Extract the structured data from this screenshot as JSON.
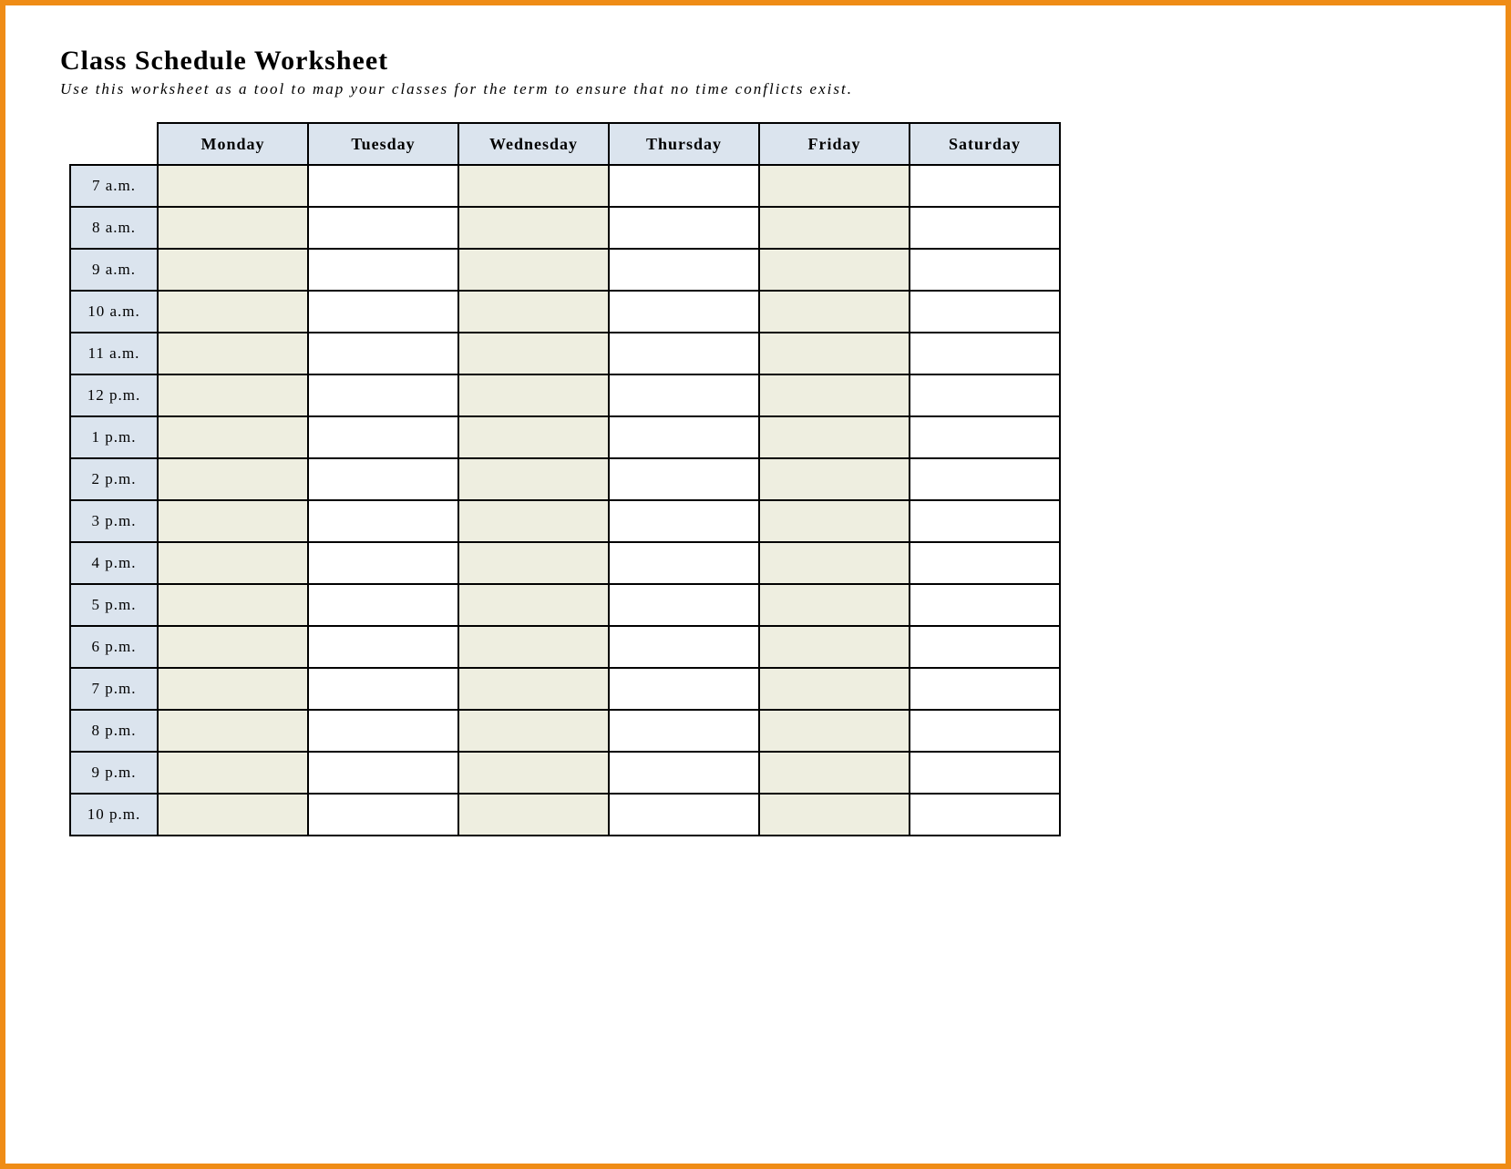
{
  "title": "Class Schedule Worksheet",
  "subtitle": "Use this worksheet as a tool to map your classes for the term to ensure that no time conflicts exist.",
  "days": [
    "Monday",
    "Tuesday",
    "Wednesday",
    "Thursday",
    "Friday",
    "Saturday"
  ],
  "times": [
    "7 a.m.",
    "8 a.m.",
    "9 a.m.",
    "10 a.m.",
    "11 a.m.",
    "12 p.m.",
    "1 p.m.",
    "2 p.m.",
    "3 p.m.",
    "4 p.m.",
    "5 p.m.",
    "6 p.m.",
    "7 p.m.",
    "8 p.m.",
    "9 p.m.",
    "10 p.m."
  ],
  "shaded_day_indices": [
    0,
    2,
    4
  ]
}
